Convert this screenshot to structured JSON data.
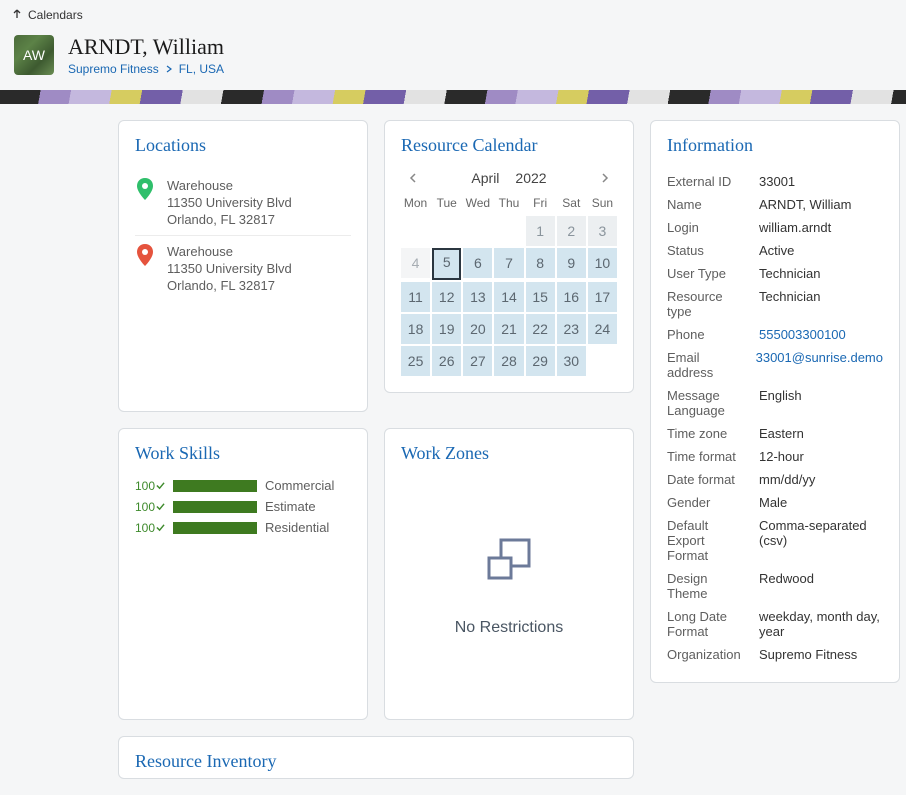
{
  "back": {
    "label": "Calendars"
  },
  "header": {
    "initials": "AW",
    "title": "ARNDT, William",
    "crumb1": "Supremo Fitness",
    "crumb2": "FL, USA"
  },
  "locations": {
    "title": "Locations",
    "items": [
      {
        "name": "Warehouse",
        "line1": "11350 University Blvd",
        "line2": "Orlando, FL 32817",
        "color": "#2fbf6b"
      },
      {
        "name": "Warehouse",
        "line1": "11350 University Blvd",
        "line2": "Orlando, FL 32817",
        "color": "#e5533d"
      }
    ]
  },
  "calendar": {
    "title": "Resource Calendar",
    "month": "April",
    "year": "2022",
    "dow": [
      "Mon",
      "Tue",
      "Wed",
      "Thu",
      "Fri",
      "Sat",
      "Sun"
    ],
    "today_index": 8,
    "cells": [
      {
        "t": "",
        "c": "empty"
      },
      {
        "t": "",
        "c": "empty"
      },
      {
        "t": "",
        "c": "empty"
      },
      {
        "t": "",
        "c": "empty"
      },
      {
        "t": "1",
        "c": "gray"
      },
      {
        "t": "2",
        "c": "gray"
      },
      {
        "t": "3",
        "c": "gray"
      },
      {
        "t": "4",
        "c": "prev"
      },
      {
        "t": "5",
        "c": "blue"
      },
      {
        "t": "6",
        "c": "blue"
      },
      {
        "t": "7",
        "c": "blue"
      },
      {
        "t": "8",
        "c": "blue"
      },
      {
        "t": "9",
        "c": "blue"
      },
      {
        "t": "10",
        "c": "blue"
      },
      {
        "t": "11",
        "c": "blue"
      },
      {
        "t": "12",
        "c": "blue"
      },
      {
        "t": "13",
        "c": "blue"
      },
      {
        "t": "14",
        "c": "blue"
      },
      {
        "t": "15",
        "c": "blue"
      },
      {
        "t": "16",
        "c": "blue"
      },
      {
        "t": "17",
        "c": "blue"
      },
      {
        "t": "18",
        "c": "blue"
      },
      {
        "t": "19",
        "c": "blue"
      },
      {
        "t": "20",
        "c": "blue"
      },
      {
        "t": "21",
        "c": "blue"
      },
      {
        "t": "22",
        "c": "blue"
      },
      {
        "t": "23",
        "c": "blue"
      },
      {
        "t": "24",
        "c": "blue"
      },
      {
        "t": "25",
        "c": "blue"
      },
      {
        "t": "26",
        "c": "blue"
      },
      {
        "t": "27",
        "c": "blue"
      },
      {
        "t": "28",
        "c": "blue"
      },
      {
        "t": "29",
        "c": "blue"
      },
      {
        "t": "30",
        "c": "blue"
      },
      {
        "t": "",
        "c": "empty"
      }
    ]
  },
  "skills": {
    "title": "Work Skills",
    "items": [
      {
        "pct": "100",
        "label": "Commercial"
      },
      {
        "pct": "100",
        "label": "Estimate"
      },
      {
        "pct": "100",
        "label": "Residential"
      }
    ]
  },
  "zones": {
    "title": "Work Zones",
    "caption": "No Restrictions"
  },
  "info": {
    "title": "Information",
    "rows": [
      {
        "k": "External ID",
        "v": "33001"
      },
      {
        "k": "Name",
        "v": "ARNDT, William"
      },
      {
        "k": "Login",
        "v": "william.arndt"
      },
      {
        "k": "Status",
        "v": "Active"
      },
      {
        "k": "User Type",
        "v": "Technician"
      },
      {
        "k": "Resource type",
        "v": "Technician"
      },
      {
        "k": "Phone",
        "v": "555003300100",
        "link": true
      },
      {
        "k": "Email address",
        "v": "33001@sunrise.demo",
        "link": true
      },
      {
        "k": "Message Language",
        "v": "English"
      },
      {
        "k": "Time zone",
        "v": "Eastern"
      },
      {
        "k": "Time format",
        "v": "12-hour"
      },
      {
        "k": "Date format",
        "v": "mm/dd/yy"
      },
      {
        "k": "Gender",
        "v": "Male"
      },
      {
        "k": "Default Export Format",
        "v": "Comma-separated (csv)"
      },
      {
        "k": "Design Theme",
        "v": "Redwood"
      },
      {
        "k": "Long Date Format",
        "v": "weekday, month day, year"
      },
      {
        "k": "Organization",
        "v": "Supremo Fitness"
      }
    ]
  },
  "inventory": {
    "title": "Resource Inventory"
  }
}
